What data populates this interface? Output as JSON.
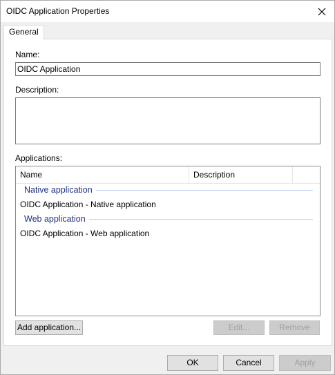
{
  "window": {
    "title": "OIDC Application Properties"
  },
  "tabs": [
    {
      "label": "General",
      "selected": true
    }
  ],
  "general": {
    "name_label": "Name:",
    "name_value": "OIDC Application",
    "description_label": "Description:",
    "description_value": "",
    "applications_label": "Applications:"
  },
  "applications_list": {
    "columns": [
      "Name",
      "Description"
    ],
    "groups": [
      {
        "header": "Native application",
        "items": [
          "OIDC Application - Native application"
        ]
      },
      {
        "header": "Web application",
        "items": [
          "OIDC Application - Web application"
        ]
      }
    ]
  },
  "list_buttons": {
    "add": "Add application...",
    "edit": "Edit...",
    "remove": "Remove"
  },
  "dialog_buttons": {
    "ok": "OK",
    "cancel": "Cancel",
    "apply": "Apply"
  },
  "colors": {
    "group_header": "#1e3287",
    "group_line": "#b9d1ea",
    "dialog_bg": "#f0f0f0"
  }
}
